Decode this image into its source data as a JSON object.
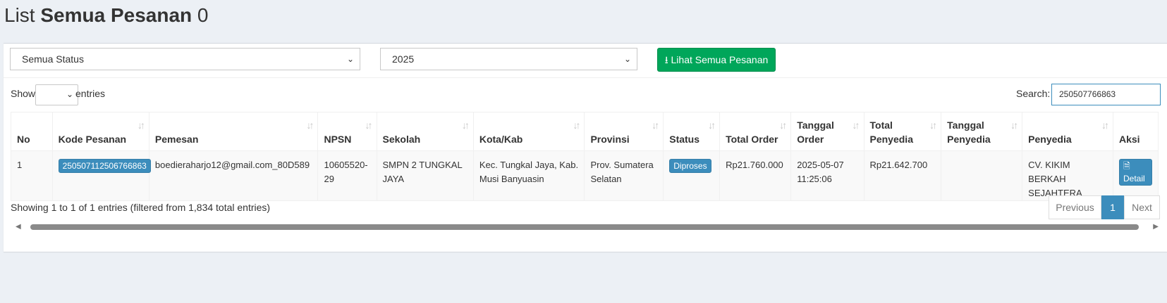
{
  "header": {
    "title_prefix": "List",
    "title_bold": "Semua Pesanan",
    "title_count": "0"
  },
  "filters": {
    "status_selected": "Semua Status",
    "year_selected": "2025",
    "view_all_label": "Lihat Semua Pesanan"
  },
  "controls": {
    "show_label": "Show",
    "entries_label": "entries",
    "search_label": "Search:",
    "search_value": "250507766863"
  },
  "table": {
    "columns": [
      "No",
      "Kode Pesanan",
      "Pemesan",
      "NPSN",
      "Sekolah",
      "Kota/Kab",
      "Provinsi",
      "Status",
      "Total Order",
      "Tanggal Order",
      "Total Penyedia",
      "Tanggal Penyedia",
      "Penyedia",
      "Aksi"
    ],
    "rows": [
      {
        "no": "1",
        "kode": "250507112506766863",
        "pemesan": "boedieraharjo12@gmail.com_80D589",
        "npsn": "10605520-29",
        "sekolah": "SMPN 2 TUNGKAL JAYA",
        "kota": "Kec. Tungkal Jaya, Kab. Musi Banyuasin",
        "provinsi": "Prov. Sumatera Selatan",
        "status": "Diproses",
        "total_order": "Rp21.760.000",
        "tanggal_order": "2025-05-07 11:25:06",
        "total_penyedia": "Rp21.642.700",
        "tanggal_penyedia": "",
        "penyedia": "CV. KIKIM BERKAH SEJAHTERA",
        "aksi": "Detail"
      }
    ]
  },
  "footer": {
    "info": "Showing 1 to 1 of 1 entries (filtered from 1,834 total entries)",
    "prev_label": "Previous",
    "page": "1",
    "next_label": "Next"
  },
  "colors": {
    "green": "#00a65a",
    "blue": "#3c8dbc",
    "background": "#ecf0f5"
  }
}
